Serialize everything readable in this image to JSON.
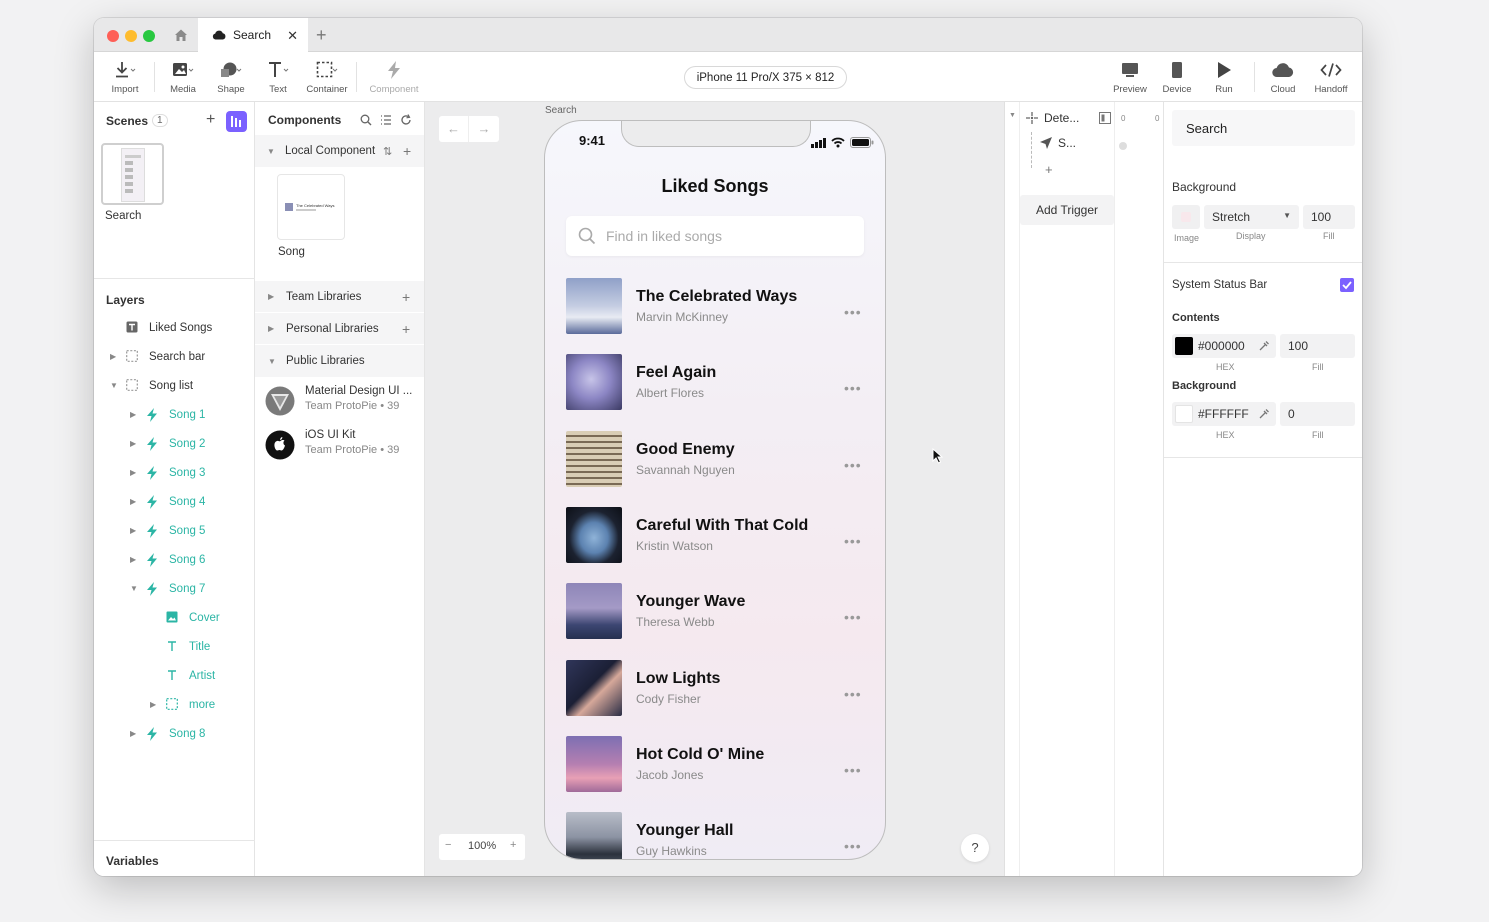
{
  "colors": {
    "accent": "#7b61ff",
    "teal": "#2bb5a5",
    "close": "#fe5f57",
    "minimize": "#febc2e",
    "maximize": "#28c840"
  },
  "tab": {
    "title": "Search",
    "close": "✕",
    "new": "+",
    "icon": "cloud-icon"
  },
  "toolbar": {
    "import": "Import",
    "media": "Media",
    "shape": "Shape",
    "text": "Text",
    "container": "Container",
    "component": "Component",
    "device": "iPhone 11 Pro/X  375 × 812",
    "preview": "Preview",
    "device_btn": "Device",
    "run": "Run",
    "cloud": "Cloud",
    "handoff": "Handoff"
  },
  "scenes": {
    "title": "Scenes",
    "count": "1",
    "thumb_label": "Search"
  },
  "layers": {
    "title": "Layers",
    "items": [
      {
        "label": "Liked Songs",
        "type": "text"
      },
      {
        "label": "Search bar",
        "type": "container"
      },
      {
        "label": "Song list",
        "type": "container"
      },
      {
        "label": "Song 1",
        "type": "component"
      },
      {
        "label": "Song 2",
        "type": "component"
      },
      {
        "label": "Song 3",
        "type": "component"
      },
      {
        "label": "Song 4",
        "type": "component"
      },
      {
        "label": "Song 5",
        "type": "component"
      },
      {
        "label": "Song 6",
        "type": "component"
      },
      {
        "label": "Song 7",
        "type": "component"
      },
      {
        "label": "Cover",
        "type": "image"
      },
      {
        "label": "Title",
        "type": "text"
      },
      {
        "label": "Artist",
        "type": "text"
      },
      {
        "label": "more",
        "type": "container"
      },
      {
        "label": "Song 8",
        "type": "component"
      }
    ]
  },
  "variables": "Variables",
  "components": {
    "title": "Components",
    "local": "Local Component",
    "song_label": "Song",
    "song_thumb_text": "The Celebrated Ways",
    "team": "Team Libraries",
    "personal": "Personal Libraries",
    "public": "Public Libraries",
    "libs": [
      {
        "name": "Material Design UI ...",
        "meta": "Team ProtoPie • 39"
      },
      {
        "name": "iOS UI Kit",
        "meta": "Team ProtoPie • 39"
      }
    ]
  },
  "canvas": {
    "scene_label": "Search",
    "zoom": "100%",
    "zoom_minus": "−",
    "zoom_plus": "+",
    "help": "?"
  },
  "phone": {
    "time": "9:41",
    "heading": "Liked Songs",
    "search_placeholder": "Find in liked songs",
    "more": "•••",
    "songs": [
      {
        "title": "The Celebrated Ways",
        "artist": "Marvin McKinney"
      },
      {
        "title": "Feel Again",
        "artist": "Albert Flores"
      },
      {
        "title": "Good Enemy",
        "artist": "Savannah Nguyen"
      },
      {
        "title": "Careful With That Cold",
        "artist": "Kristin Watson"
      },
      {
        "title": "Younger Wave",
        "artist": "Theresa Webb"
      },
      {
        "title": "Low Lights",
        "artist": "Cody Fisher"
      },
      {
        "title": "Hot Cold O' Mine",
        "artist": "Jacob Jones"
      },
      {
        "title": "Younger Hall",
        "artist": "Guy Hawkins"
      }
    ]
  },
  "interactions": {
    "trigger_name": "Dete...",
    "response_name": "S...",
    "add": "+",
    "add_trigger": "Add Trigger",
    "ruler_a": "0",
    "ruler_b": "0"
  },
  "props": {
    "scene_name": "Search",
    "background_title": "Background",
    "display": "Stretch",
    "fill": "100",
    "cap_image": "Image",
    "cap_display": "Display",
    "cap_fill": "Fill",
    "status_bar": "System Status Bar",
    "status_bar_checked": true,
    "contents_title": "Contents",
    "contents_hex": "#000000",
    "contents_fill": "100",
    "cap_hex": "HEX",
    "bg2_title": "Background",
    "bg2_hex": "#FFFFFF",
    "bg2_fill": "0"
  }
}
